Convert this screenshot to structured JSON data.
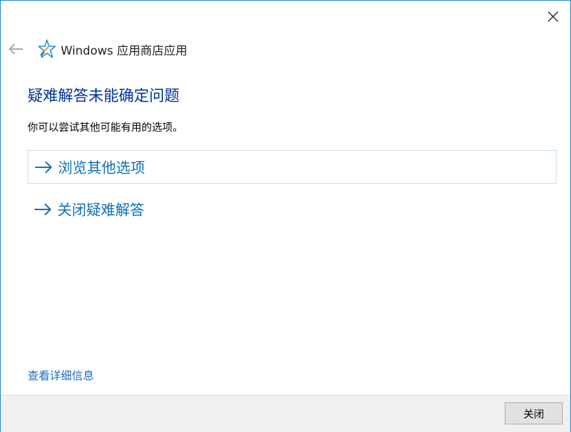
{
  "window": {
    "app_title": "Windows 应用商店应用",
    "app_icon": "windows-store-troubleshooter-icon"
  },
  "titlebar": {
    "close_icon": "close-icon",
    "back_icon": "back-arrow-icon"
  },
  "main": {
    "heading": "疑难解答未能确定问题",
    "subtext": "你可以尝试其他可能有用的选项。",
    "options": [
      {
        "label": "浏览其他选项",
        "icon": "arrow-right-icon"
      },
      {
        "label": "关闭疑难解答",
        "icon": "arrow-right-icon"
      }
    ],
    "details_link": "查看详细信息"
  },
  "footer": {
    "close_button_label": "关闭"
  },
  "colors": {
    "heading": "#003399",
    "link": "#0e6fb8",
    "accent_border": "#1883d7",
    "footer_bg": "#f0f0f0"
  }
}
